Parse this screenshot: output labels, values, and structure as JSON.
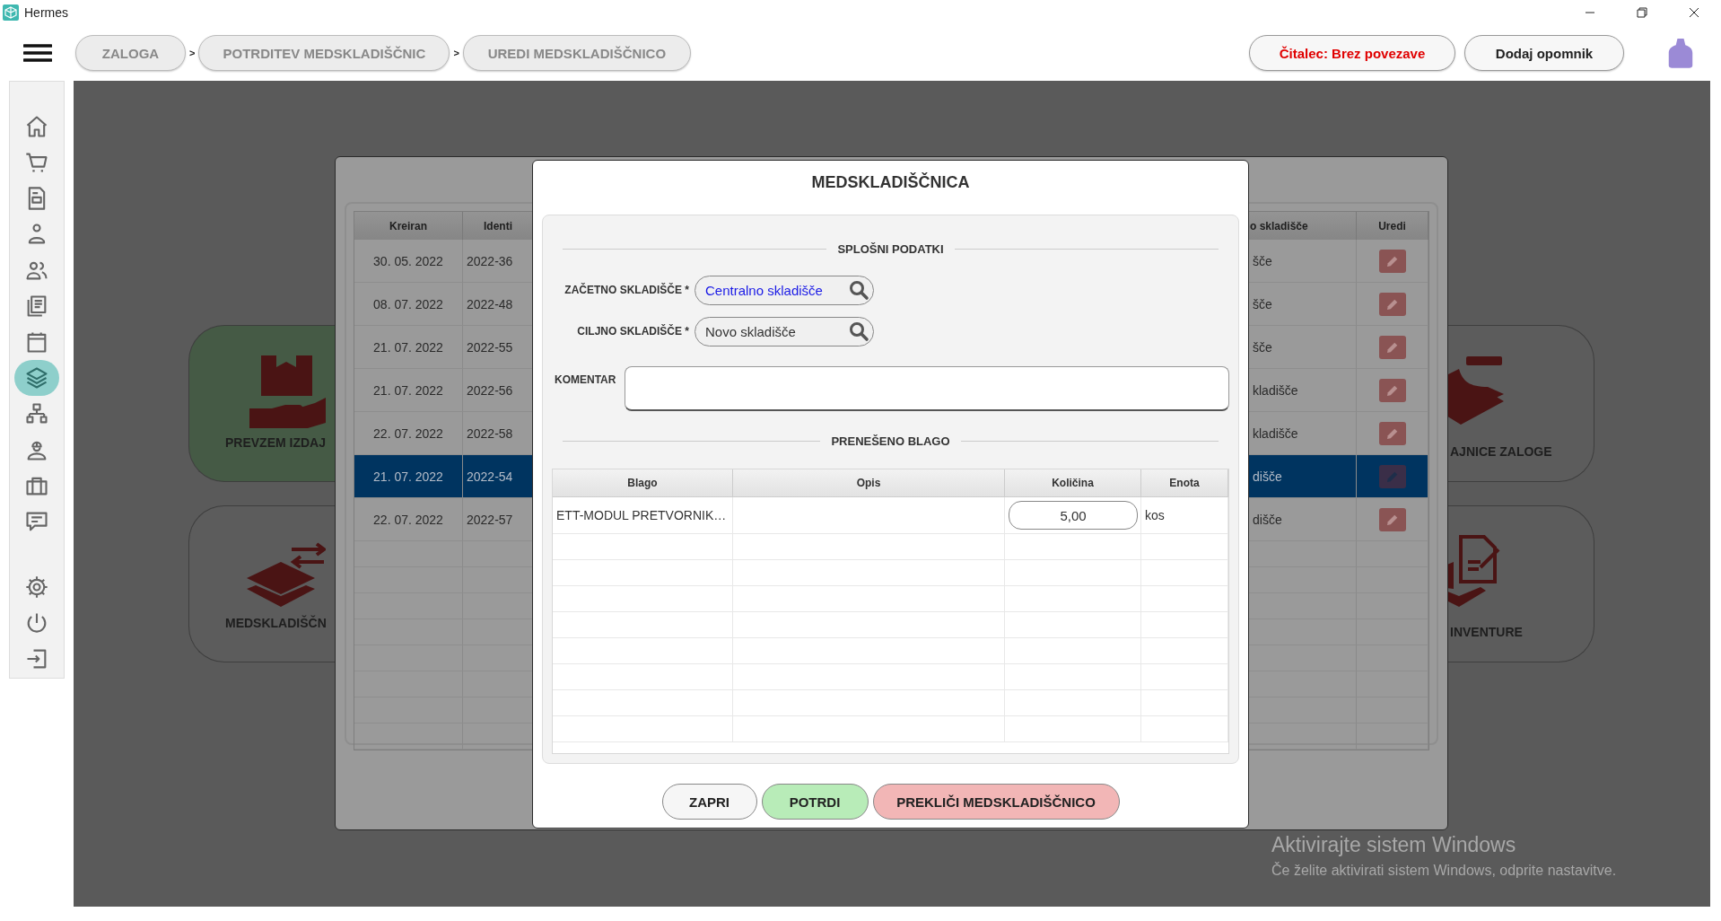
{
  "window": {
    "title": "Hermes"
  },
  "breadcrumbs": {
    "separator": ">",
    "items": [
      {
        "label": "ZALOGA"
      },
      {
        "label": "POTRDITEV MEDSKLADIŠČNIC"
      },
      {
        "label": "UREDI MEDSKLADIŠČNICO"
      }
    ]
  },
  "reader_status": "Čitalec: Brez povezave",
  "reminder_button": "Dodaj opomnik",
  "sidebar": {
    "items": [
      {
        "selected": false
      },
      {
        "selected": false
      },
      {
        "selected": false
      },
      {
        "selected": false
      },
      {
        "selected": false
      },
      {
        "selected": false
      },
      {
        "selected": false
      },
      {
        "selected": true
      },
      {
        "selected": false
      },
      {
        "selected": false
      },
      {
        "selected": false
      },
      {
        "selected": false
      },
      {
        "selected": false
      },
      {
        "selected": false
      },
      {
        "selected": false
      }
    ]
  },
  "tiles": [
    {
      "label": "PREVZEM IZDAJ",
      "color": "#455a45"
    },
    {
      "label": "MEDSKLADIŠČN",
      "color": "#5c5c5c"
    },
    {
      "label": "AJNICE ZALOGE",
      "color": "#5c5c5c"
    },
    {
      "label": "INVENTURE",
      "color": "#5c5c5c"
    }
  ],
  "background_table": {
    "columns": [
      "Kreiran",
      "Identi",
      "o skladišče",
      "Uredi"
    ],
    "rows": [
      {
        "created": "30. 05. 2022",
        "id": "2022-36",
        "column_3": "šče",
        "selected": false
      },
      {
        "created": "08. 07. 2022",
        "id": "2022-48",
        "column_3": "šče",
        "selected": false
      },
      {
        "created": "21. 07. 2022",
        "id": "2022-55",
        "column_3": "šče",
        "selected": false
      },
      {
        "created": "21. 07. 2022",
        "id": "2022-56",
        "column_3": "kladišče",
        "selected": false
      },
      {
        "created": "22. 07. 2022",
        "id": "2022-58",
        "column_3": "kladišče",
        "selected": false
      },
      {
        "created": "21. 07. 2022",
        "id": "2022-54",
        "column_3": "dišče",
        "selected": true
      },
      {
        "created": "22. 07. 2022",
        "id": "2022-57",
        "column_3": "dišče",
        "selected": false
      }
    ]
  },
  "dialog": {
    "title": "MEDSKLADIŠČNICA",
    "general_heading": "SPLOŠNI PODATKI",
    "fields": [
      {
        "label": "ZAČETNO SKLADIŠČE *",
        "value": "Centralno skladišče",
        "changed": true
      },
      {
        "label": "CILJNO SKLADIŠČE *",
        "value": "Novo skladišče",
        "changed": false
      }
    ],
    "comment_label": "KOMENTAR",
    "items_heading": "PRENEŠENO BLAGO",
    "items_table": {
      "columns": [
        "Blago",
        "Opis",
        "Količina",
        "Enota"
      ],
      "rows": [
        {
          "blago": "ETT-MODUL PRETVORNIK…",
          "quantity": "5,00",
          "unit": "kos"
        }
      ]
    },
    "buttons": [
      {
        "label": "ZAPRI",
        "kind": "default"
      },
      {
        "label": "POTRDI",
        "kind": "confirm"
      },
      {
        "label": "PREKLIČI MEDSKLADIŠČNICO",
        "kind": "danger"
      }
    ]
  },
  "activation_notice": {
    "title": "Aktivirajte sistem Windows",
    "text": "Če želite aktivirati sistem Windows, odprite nastavitve."
  }
}
